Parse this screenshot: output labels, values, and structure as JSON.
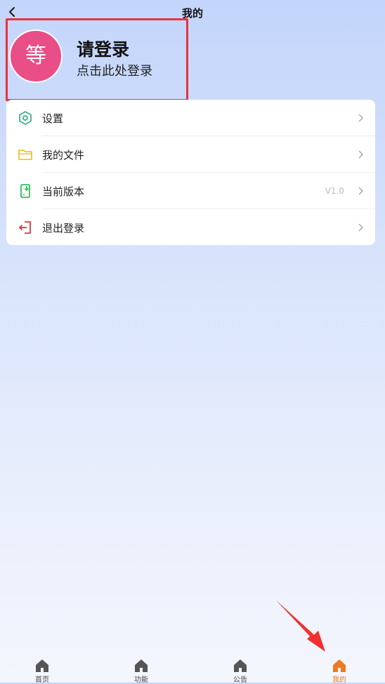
{
  "header": {
    "title": "我的"
  },
  "profile": {
    "avatar_text": "等",
    "title": "请登录",
    "subtitle": "点击此处登录"
  },
  "menu": [
    {
      "label": "设置",
      "icon": "hexagon-settings-icon",
      "value": ""
    },
    {
      "label": "我的文件",
      "icon": "folder-icon",
      "value": ""
    },
    {
      "label": "当前版本",
      "icon": "phone-download-icon",
      "value": "V1.0"
    },
    {
      "label": "退出登录",
      "icon": "logout-icon",
      "value": ""
    }
  ],
  "tabs": [
    {
      "label": "首页",
      "active": false
    },
    {
      "label": "功能",
      "active": false
    },
    {
      "label": "公告",
      "active": false
    },
    {
      "label": "我的",
      "active": true
    }
  ],
  "colors": {
    "accent_tab": "#ee7a20",
    "avatar": "#ea4e86",
    "highlight": "#e8323c"
  }
}
